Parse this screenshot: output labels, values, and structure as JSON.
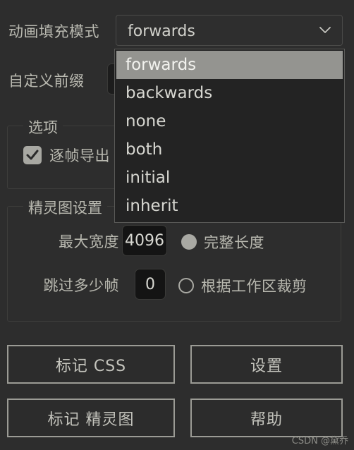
{
  "panel": {
    "background": "#2d2d2d",
    "text_color": "#b9b9b0"
  },
  "fill_mode": {
    "label": "动画填充模式",
    "selected": "forwards",
    "chevron_icon": "chevron-down-icon",
    "options": [
      "forwards",
      "backwards",
      "none",
      "both",
      "initial",
      "inherit"
    ],
    "dropdown_open": true,
    "highlight_color": "#949490"
  },
  "prefix": {
    "label": "自定义前缀",
    "value": "",
    "placeholder": ""
  },
  "options_group": {
    "legend": "选项",
    "checkbox": {
      "label": "逐帧导出",
      "checked": true,
      "icon": "check-icon"
    }
  },
  "sprite_group": {
    "legend": "精灵图设置",
    "max_width": {
      "label": "最大宽度",
      "value": "4096"
    },
    "skip_frames": {
      "label": "跳过多少帧",
      "value": "0"
    },
    "radios": [
      {
        "label": "完整长度",
        "selected": true
      },
      {
        "label": "根据工作区裁剪",
        "selected": false
      }
    ]
  },
  "buttons": {
    "mark_css": "标记 CSS",
    "settings": "设置",
    "mark_sprite": "标记 精灵图",
    "help": "帮助"
  },
  "watermark": "CSDN @黛乔"
}
